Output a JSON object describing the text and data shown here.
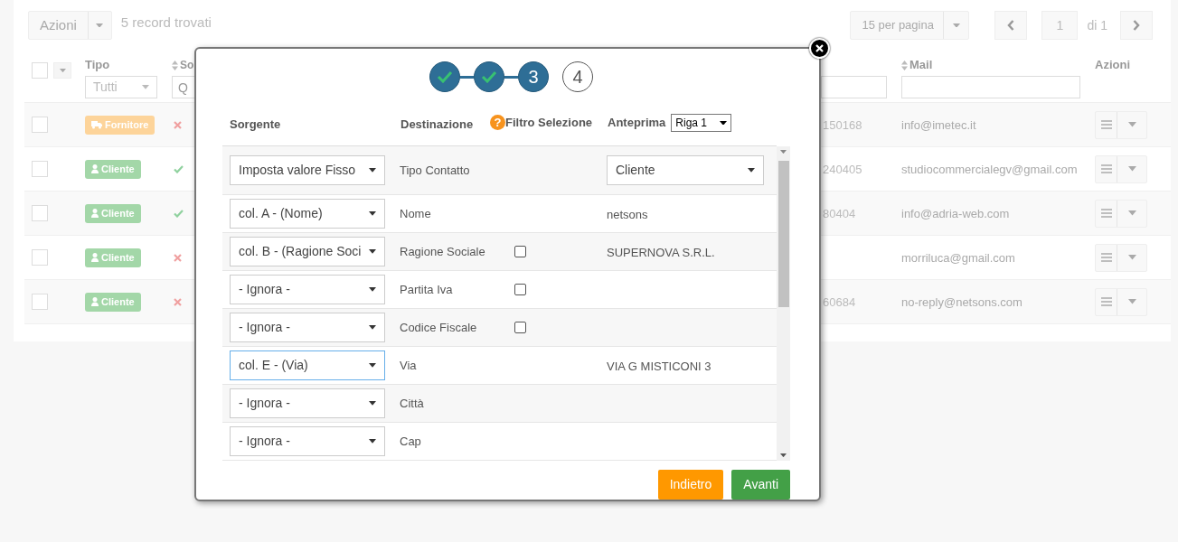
{
  "toolbar": {
    "actions_button": "Azioni",
    "record_count": "5 record trovati",
    "per_page": "15 per pagina",
    "page": "1",
    "page_total": "di 1"
  },
  "table": {
    "columns": [
      {
        "label": "Tipo",
        "sortable": false,
        "filter": {
          "kind": "select",
          "value": "Tutti"
        }
      },
      {
        "label": "So",
        "sortable": true,
        "filter": {
          "kind": "input",
          "placeholder": "Q"
        }
      },
      {
        "filter": {
          "kind": "input"
        }
      },
      {
        "label": "Mail",
        "sortable": true,
        "filter": {
          "kind": "input"
        }
      },
      {
        "label": "Azioni"
      }
    ],
    "all_selected": false,
    "rows": [
      {
        "selected": false,
        "type": {
          "label": "Fornitore",
          "kind": "supplier"
        },
        "active": false,
        "phone": "150168",
        "mail": "info@imetec.it"
      },
      {
        "selected": false,
        "type": {
          "label": "Cliente",
          "kind": "customer"
        },
        "active": true,
        "phone": "240405",
        "mail": "studiocommercialegv@gmail.com"
      },
      {
        "selected": false,
        "type": {
          "label": "Cliente",
          "kind": "customer"
        },
        "active": true,
        "phone": "80404",
        "mail": "info@adria-web.com"
      },
      {
        "selected": false,
        "type": {
          "label": "Cliente",
          "kind": "customer"
        },
        "active": false,
        "mail": "morriluca@gmail.com"
      },
      {
        "selected": false,
        "type": {
          "label": "Cliente",
          "kind": "customer"
        },
        "active": false,
        "phone": "60684",
        "mail": "no-reply@netsons.com"
      }
    ]
  },
  "import_wizard": {
    "steps": [
      {
        "kind": "done"
      },
      {
        "kind": "done"
      },
      {
        "label": "3",
        "kind": "current"
      },
      {
        "label": "4",
        "kind": "pending"
      }
    ],
    "columns": {
      "source": "Sorgente",
      "destination": "Destinazione",
      "filter_help": "?",
      "filter": "Filtro Selezione",
      "preview": "Anteprima"
    },
    "preview_row": "Riga 1",
    "mappings": [
      {
        "source": "Imposta valore Fisso",
        "focused": false,
        "destination": "Tipo Contatto",
        "preview": {
          "kind": "select",
          "value": "Cliente"
        }
      },
      {
        "source": "col. A - (Nome)",
        "focused": false,
        "destination": "Nome",
        "preview": {
          "kind": "text",
          "value": "netsons"
        }
      },
      {
        "source": "col. B - (Ragione Soci",
        "focused": false,
        "destination": "Ragione Sociale",
        "filter": {
          "checked": false
        },
        "preview": {
          "kind": "text",
          "value": "SUPERNOVA S.R.L."
        }
      },
      {
        "source": "- Ignora -",
        "focused": false,
        "destination": "Partita Iva",
        "filter": {
          "checked": false
        }
      },
      {
        "source": "- Ignora -",
        "focused": false,
        "destination": "Codice Fiscale",
        "filter": {
          "checked": false
        }
      },
      {
        "source": "col. E - (Via)",
        "focused": true,
        "destination": "Via",
        "preview": {
          "kind": "text",
          "value": "VIA G MISTICONI 3"
        }
      },
      {
        "source": "- Ignora -",
        "focused": false,
        "destination": "Città"
      },
      {
        "source": "- Ignora -",
        "focused": false,
        "destination": "Cap"
      }
    ],
    "buttons": {
      "back": "Indietro",
      "next": "Avanti"
    }
  }
}
